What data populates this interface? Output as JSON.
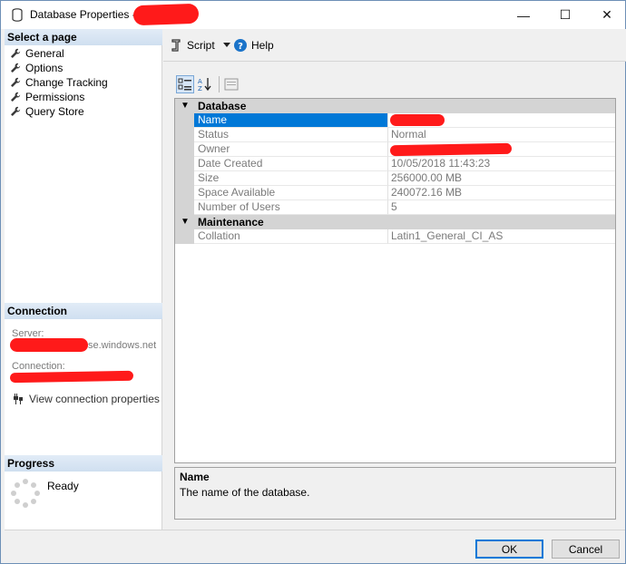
{
  "window": {
    "title": "Database Properties -",
    "controls": {
      "minimize": "—",
      "maximize": "☐",
      "close": "✕"
    }
  },
  "left": {
    "select_page_header": "Select a page",
    "pages": [
      {
        "label": "General"
      },
      {
        "label": "Options"
      },
      {
        "label": "Change Tracking"
      },
      {
        "label": "Permissions"
      },
      {
        "label": "Query Store"
      }
    ],
    "connection_header": "Connection",
    "server_label": "Server:",
    "server_value_suffix": "se.windows.net",
    "connection_label": "Connection:",
    "view_connection_properties": "View connection properties",
    "progress_header": "Progress",
    "progress_status": "Ready"
  },
  "toolbar": {
    "script_label": "Script",
    "help_label": "Help"
  },
  "grid": {
    "categories": [
      {
        "label": "Database",
        "rows": [
          {
            "name": "Name",
            "value": ""
          },
          {
            "name": "Status",
            "value": "Normal"
          },
          {
            "name": "Owner",
            "value": ""
          },
          {
            "name": "Date Created",
            "value": "10/05/2018 11:43:23"
          },
          {
            "name": "Size",
            "value": "256000.00 MB"
          },
          {
            "name": "Space Available",
            "value": "240072.16 MB"
          },
          {
            "name": "Number of Users",
            "value": "5"
          }
        ]
      },
      {
        "label": "Maintenance",
        "rows": [
          {
            "name": "Collation",
            "value": "Latin1_General_CI_AS"
          }
        ]
      }
    ]
  },
  "description": {
    "title": "Name",
    "text": "The name of the database."
  },
  "buttons": {
    "ok": "OK",
    "cancel": "Cancel"
  },
  "colors": {
    "selection": "#0078d7",
    "redaction": "#ff1a1a",
    "category_bg": "#d4d4d4"
  }
}
